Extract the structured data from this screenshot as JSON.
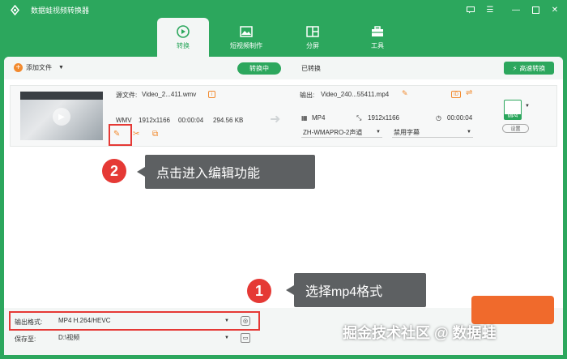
{
  "app": {
    "title": "数据蛙视频转换器"
  },
  "tabs": [
    {
      "label": "转换",
      "icon": "convert-icon"
    },
    {
      "label": "短视频制作",
      "icon": "image-icon"
    },
    {
      "label": "分屏",
      "icon": "split-screen-icon"
    },
    {
      "label": "工具",
      "icon": "toolbox-icon"
    }
  ],
  "toolbar": {
    "add_label": "添加文件",
    "converting": "转换中",
    "converted": "已转换",
    "fast_convert": "高速转换"
  },
  "file": {
    "source_label": "源文件:",
    "source_name": "Video_2...411.wmv",
    "format": "WMV",
    "resolution": "1912x1166",
    "duration": "00:00:04",
    "size": "294.56 KB",
    "output_label": "输出:",
    "output_name": "Video_240...55411.mp4",
    "out_format": "MP4",
    "out_resolution": "1912x1166",
    "out_duration": "00:00:04",
    "audio_option": "ZH-WMAPRO-2声道",
    "subtitle_option": "禁用字幕",
    "out_format_tag": "MP4",
    "settings_label": "设置"
  },
  "annotations": {
    "step2_num": "2",
    "step2_text": "点击进入编辑功能",
    "step1_num": "1",
    "step1_text": "选择mp4格式"
  },
  "bottom": {
    "format_label": "输出格式:",
    "format_value": "MP4 H.264/HEVC",
    "save_label": "保存至:",
    "save_path": "D:\\视频"
  },
  "watermark": "掘金技术社区 @ 数据蛙",
  "colors": {
    "brand_green": "#2ca75d",
    "accent_orange": "#f28a2e",
    "annotation_red": "#e53935"
  }
}
